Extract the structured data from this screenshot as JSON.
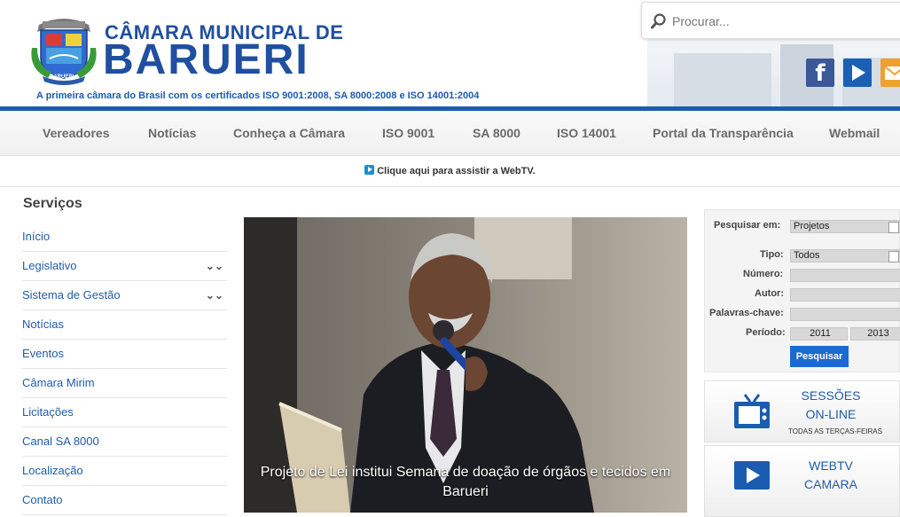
{
  "header": {
    "brand_line1": "CÂMARA MUNICIPAL DE",
    "brand_line2": "BARUERI",
    "tagline": "A primeira câmara do Brasil com os certificados ISO 9001:2008, SA 8000:2008 e ISO 14001:2004",
    "crest_ribbon": "BARUERI",
    "search_placeholder": "Procurar...",
    "social": {
      "facebook_letter": "f"
    }
  },
  "nav": {
    "items": [
      "Vereadores",
      "Notícias",
      "Conheça a Câmara",
      "ISO 9001",
      "SA 8000",
      "ISO 14001",
      "Portal da Transparência",
      "Webmail"
    ]
  },
  "webtv_link": "Clique aqui para assistir a WebTV.",
  "sidebar": {
    "title": "Serviços",
    "items": [
      {
        "label": "Início",
        "expandable": false
      },
      {
        "label": "Legislativo",
        "expandable": true
      },
      {
        "label": "Sistema de Gestão",
        "expandable": true
      },
      {
        "label": "Notícias",
        "expandable": false
      },
      {
        "label": "Eventos",
        "expandable": false
      },
      {
        "label": "Câmara Mirim",
        "expandable": false
      },
      {
        "label": "Licitações",
        "expandable": false
      },
      {
        "label": "Canal SA 8000",
        "expandable": false
      },
      {
        "label": "Localização",
        "expandable": false
      },
      {
        "label": "Contato",
        "expandable": false
      }
    ],
    "chevron": "⌄⌄"
  },
  "hero": {
    "caption": "Projeto de Lei institui Semana de doação de órgãos e tecidos em Barueri"
  },
  "search_form": {
    "search_in_label": "Pesquisar em:",
    "search_in_value": "Projetos",
    "tipo_label": "Tipo:",
    "tipo_value": "Todos",
    "numero_label": "Número:",
    "numero_value": "",
    "autor_label": "Autor:",
    "autor_value": "",
    "keywords_label": "Palavras-chave:",
    "keywords_value": "",
    "periodo_label": "Período:",
    "periodo_from": "2011",
    "periodo_to": "2013",
    "submit": "Pesquisar"
  },
  "sessoes": {
    "line1": "SESSÕES",
    "line2": "ON-LINE",
    "sub": "TODAS AS TERÇAS-FEIRAS"
  },
  "webtv_panel": {
    "line1": "WEBTV",
    "line2": "CAMARA"
  },
  "colors": {
    "brand_blue": "#1f4fa0",
    "link_blue": "#1f5ca8",
    "bar_blue": "#1a5cb0"
  }
}
